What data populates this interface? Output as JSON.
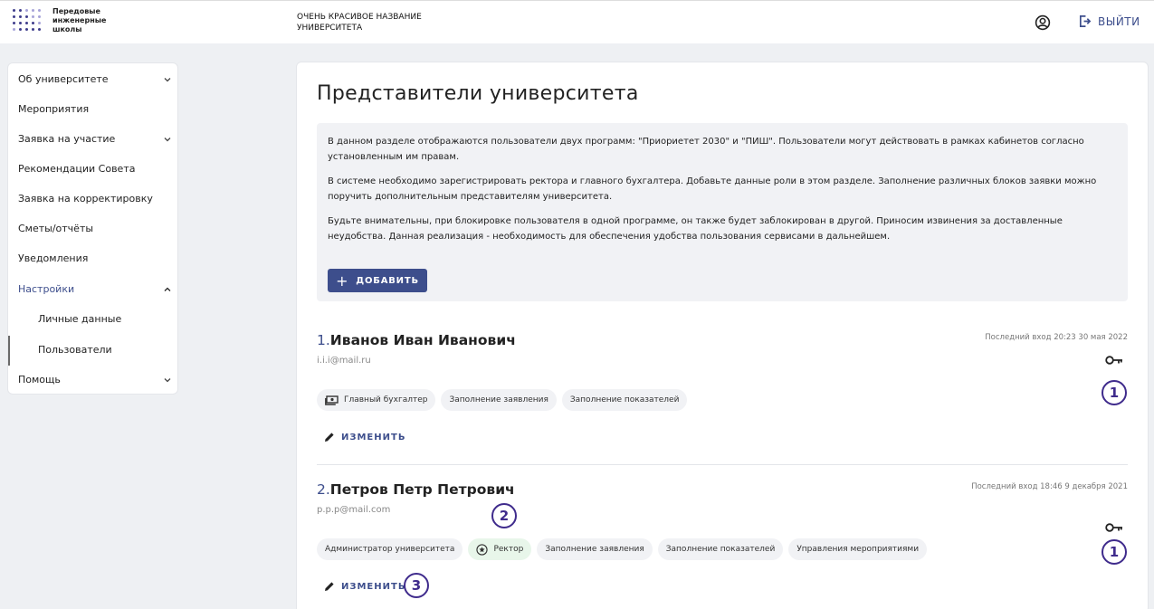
{
  "header": {
    "logo_lines": [
      "Передовые",
      "инженерные",
      "школы"
    ],
    "app_title": "ОЧЕНЬ КРАСИВОЕ НАЗВАНИЕ УНИВЕРСИТЕТА",
    "logout_label": "ВЫЙТИ",
    "user_icon": "account-circle-icon",
    "logout_icon": "logout-icon"
  },
  "sidebar": {
    "items": [
      {
        "label": "Об университете",
        "expandable": true,
        "expanded": false
      },
      {
        "label": "Мероприятия",
        "expandable": false
      },
      {
        "label": "Заявка на участие",
        "expandable": true,
        "expanded": false
      },
      {
        "label": "Рекомендации Совета",
        "expandable": false
      },
      {
        "label": "Заявка на корректировку",
        "expandable": false
      },
      {
        "label": "Сметы/отчёты",
        "expandable": false
      },
      {
        "label": "Уведомления",
        "expandable": false
      },
      {
        "label": "Настройки",
        "expandable": true,
        "expanded": true,
        "active": true
      },
      {
        "label": "Личные данные",
        "sub": true
      },
      {
        "label": "Пользователи",
        "sub": true,
        "selected": true
      },
      {
        "label": "Помощь",
        "expandable": true,
        "expanded": false
      }
    ]
  },
  "main": {
    "title": "Представители университета",
    "info": [
      "В данном разделе отображаются пользователи двух программ: \"Приориетет 2030\" и \"ПИШ\". Пользователи могут действовать в рамках кабинетов согласно установленным им правам.",
      "В системе необходимо зарегистрировать ректора и главного бухгалтера. Добавьте данные роли в этом разделе. Заполнение различных блоков заявки можно поручить дополнительным представителям университета.",
      "Будьте внимательны, при блокировке пользователя в одной программе, он также будет заблокирован в другой. Приносим извинения за доставленные неудобства. Данная реализация - необходимость для обеспечения удобства пользования сервисами в дальнейшем."
    ],
    "add_label": "ДОБАВИТЬ",
    "users": [
      {
        "num": "1.",
        "name": "Иванов Иван Иванович",
        "email": "i.i.i@mail.ru",
        "last_login": "Последний вход 20:23 30 мая 2022",
        "chips": [
          "Главный бухгалтер",
          "Заполнение заявления",
          "Заполнение показателей"
        ],
        "edit_label": "ИЗМЕНИТЬ"
      },
      {
        "num": "2.",
        "name": "Петров Петр Петрович",
        "email": "p.p.p@mail.com",
        "last_login": "Последний вход 18:46 9 декабря 2021",
        "chips": [
          "Администратор университета",
          "Ректор",
          "Заполнение заявления",
          "Заполнение показателей",
          "Управления мероприятиями"
        ],
        "edit_label": "ИЗМЕНИТЬ"
      }
    ],
    "annotations": [
      "1",
      "2",
      "3"
    ]
  },
  "colors": {
    "accent": "#3d4e8c",
    "annotation": "#3f2b8c",
    "chip_bg": "#f1f2f5",
    "chip_green_bg": "#e8f6ea"
  }
}
